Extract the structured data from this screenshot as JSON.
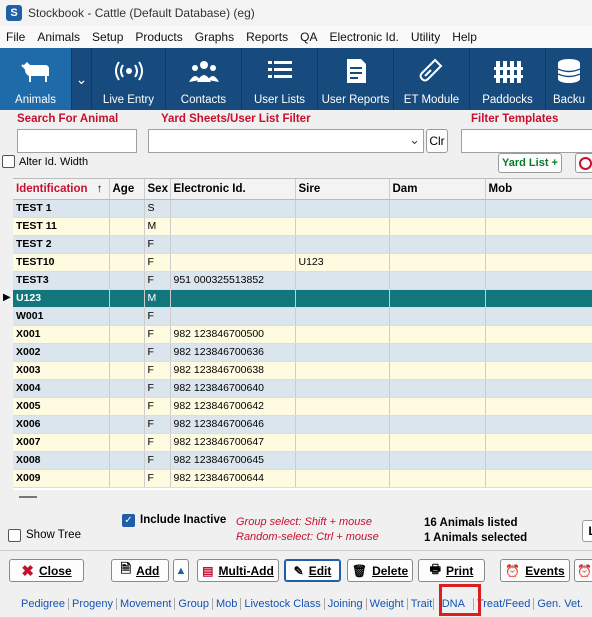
{
  "window": {
    "title": "Stockbook - Cattle (Default Database) (eg)",
    "icon_letter": "S"
  },
  "menu": [
    "File",
    "Animals",
    "Setup",
    "Products",
    "Graphs",
    "Reports",
    "QA",
    "Electronic Id.",
    "Utility",
    "Help"
  ],
  "toolbar": {
    "animals": "Animals",
    "live_entry": "Live Entry",
    "contacts": "Contacts",
    "user_lists": "User Lists",
    "user_reports": "User Reports",
    "et_module": "ET Module",
    "paddocks": "Paddocks",
    "backup": "Backu"
  },
  "search": {
    "search_label": "Search For Animal",
    "yard_label": "Yard Sheets/User List Filter",
    "templates_label": "Filter Templates",
    "clr": "Clr",
    "alter_id": "Alter Id. Width",
    "yard_list_btn": "Yard List +"
  },
  "grid": {
    "columns": [
      "Identification",
      "Age",
      "Sex",
      "Electronic Id.",
      "Sire",
      "Dam",
      "Mob"
    ],
    "rows": [
      {
        "id": "TEST 1",
        "sex": "S",
        "eid": "",
        "sire": ""
      },
      {
        "id": "TEST 11",
        "sex": "M",
        "eid": "",
        "sire": ""
      },
      {
        "id": "TEST 2",
        "sex": "F",
        "eid": "",
        "sire": ""
      },
      {
        "id": "TEST10",
        "sex": "F",
        "eid": "",
        "sire": "U123"
      },
      {
        "id": "TEST3",
        "sex": "F",
        "eid": "951 000325513852",
        "sire": ""
      },
      {
        "id": "U123",
        "sex": "M",
        "eid": "",
        "sire": ""
      },
      {
        "id": "W001",
        "sex": "F",
        "eid": "",
        "sire": ""
      },
      {
        "id": "X001",
        "sex": "F",
        "eid": "982 123846700500",
        "sire": ""
      },
      {
        "id": "X002",
        "sex": "F",
        "eid": "982 123846700636",
        "sire": ""
      },
      {
        "id": "X003",
        "sex": "F",
        "eid": "982 123846700638",
        "sire": ""
      },
      {
        "id": "X004",
        "sex": "F",
        "eid": "982 123846700640",
        "sire": ""
      },
      {
        "id": "X005",
        "sex": "F",
        "eid": "982 123846700642",
        "sire": ""
      },
      {
        "id": "X006",
        "sex": "F",
        "eid": "982 123846700646",
        "sire": ""
      },
      {
        "id": "X007",
        "sex": "F",
        "eid": "982 123846700647",
        "sire": ""
      },
      {
        "id": "X008",
        "sex": "F",
        "eid": "982 123846700645",
        "sire": ""
      },
      {
        "id": "X009",
        "sex": "F",
        "eid": "982 123846700644",
        "sire": ""
      }
    ],
    "selected_row": "U123"
  },
  "status": {
    "show_tree": "Show Tree",
    "include_inactive": "Include Inactive",
    "group_hint": "Group select: Shift + mouse",
    "random_hint": "Random-select: Ctrl + mouse",
    "listed": "16 Animals listed",
    "selected": "1 Animals selected",
    "right_btn": "L"
  },
  "actions": {
    "close": "Close",
    "add": "Add",
    "multi_add": "Multi-Add",
    "edit": "Edit",
    "delete": "Delete",
    "print": "Print",
    "events": "Events"
  },
  "tabs": [
    "Pedigree",
    "Progeny",
    "Movement",
    "Group",
    "Mob",
    "Livestock Class",
    "Joining",
    "Weight",
    "Trait",
    "DNA",
    "Treat/Feed",
    "Gen. Vet."
  ],
  "colors": {
    "toolbar": "#174b7e",
    "selected_row": "#13767d",
    "accent_red": "#c8102e",
    "highlight_box": "#d91f1f"
  }
}
